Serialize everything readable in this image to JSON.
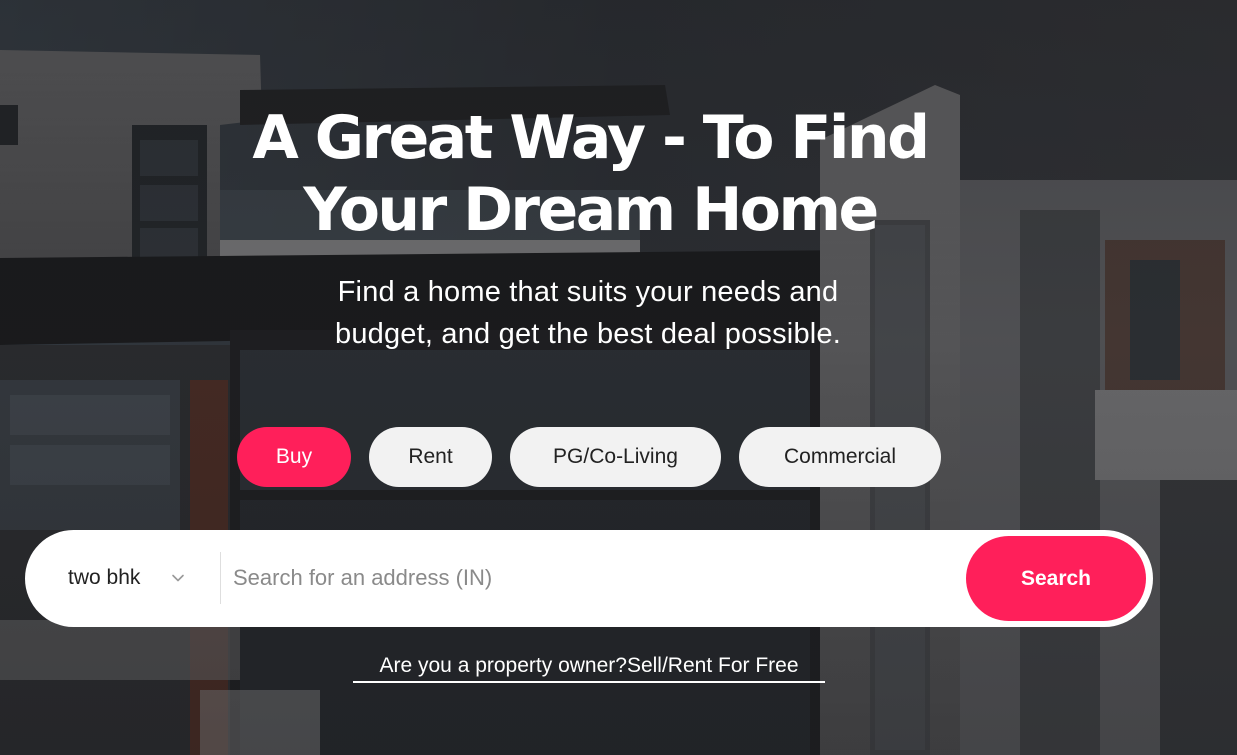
{
  "hero": {
    "title_line1": "A Great Way - To Find",
    "title_line2": "Your Dream Home",
    "subtitle_line1": "Find a home that suits your needs and",
    "subtitle_line2": "budget, and get the best deal possible."
  },
  "categories": {
    "active": "Buy",
    "items": [
      {
        "label": "Buy"
      },
      {
        "label": "Rent"
      },
      {
        "label": "PG/Co-Living"
      },
      {
        "label": "Commercial"
      }
    ]
  },
  "search": {
    "property_type": "two bhk",
    "placeholder": "Search for an address (IN)",
    "value": "",
    "button_label": "Search"
  },
  "owner_link": {
    "text": "Are you a property owner?Sell/Rent For Free"
  },
  "colors": {
    "accent": "#ff1f5a",
    "pill_bg": "#f2f2f2",
    "text_dark": "#222222",
    "text_light": "#ffffff"
  }
}
